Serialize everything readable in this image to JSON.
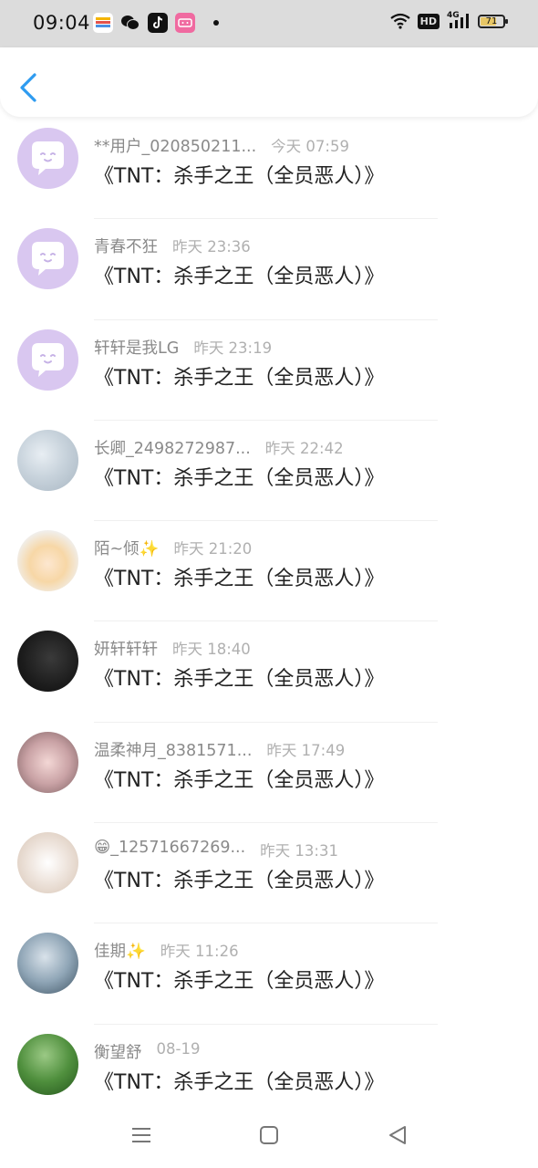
{
  "status_bar": {
    "time": "09:04",
    "network": "4G",
    "hd_label": "HD",
    "battery_level": "71"
  },
  "header": {
    "back_icon": "chevron-left-icon",
    "accent_color": "#2e9bf0"
  },
  "conversations": [
    {
      "name": "**用户_020850211...",
      "time": "今天 07:59",
      "message": "《TNT：杀手之王（全员恶人）》",
      "avatar": "chat-bubble-avatar"
    },
    {
      "name": "青春不狂",
      "time": "昨天 23:36",
      "message": "《TNT：杀手之王（全员恶人）》",
      "avatar": "chat-bubble-avatar"
    },
    {
      "name": "轩轩是我LG",
      "time": "昨天 23:19",
      "message": "《TNT：杀手之王（全员恶人）》",
      "avatar": "chat-bubble-avatar"
    },
    {
      "name": "长卿_2498272987...",
      "time": "昨天 22:42",
      "message": "《TNT：杀手之王（全员恶人）》",
      "avatar": "photo-avatar"
    },
    {
      "name": "陌~倾✨",
      "time": "昨天 21:20",
      "message": "《TNT：杀手之王（全员恶人）》",
      "avatar": "photo-avatar"
    },
    {
      "name": "妍轩轩轩",
      "time": "昨天 18:40",
      "message": "《TNT：杀手之王（全员恶人）》",
      "avatar": "photo-avatar"
    },
    {
      "name": "温柔神月_8381571...",
      "time": "昨天 17:49",
      "message": "《TNT：杀手之王（全员恶人）》",
      "avatar": "photo-avatar"
    },
    {
      "name": "😁_12571667269...",
      "time": "昨天 13:31",
      "message": "《TNT：杀手之王（全员恶人）》",
      "avatar": "photo-avatar"
    },
    {
      "name": "佳期✨",
      "time": "昨天 11:26",
      "message": "《TNT：杀手之王（全员恶人）》",
      "avatar": "photo-avatar"
    },
    {
      "name": "衡望舒",
      "time": "08-19",
      "message": "《TNT：杀手之王（全员恶人）》",
      "avatar": "photo-avatar"
    }
  ],
  "bottom_nav": {
    "menu_icon": "menu-icon",
    "home_icon": "home-square-icon",
    "back_icon": "back-triangle-icon"
  }
}
